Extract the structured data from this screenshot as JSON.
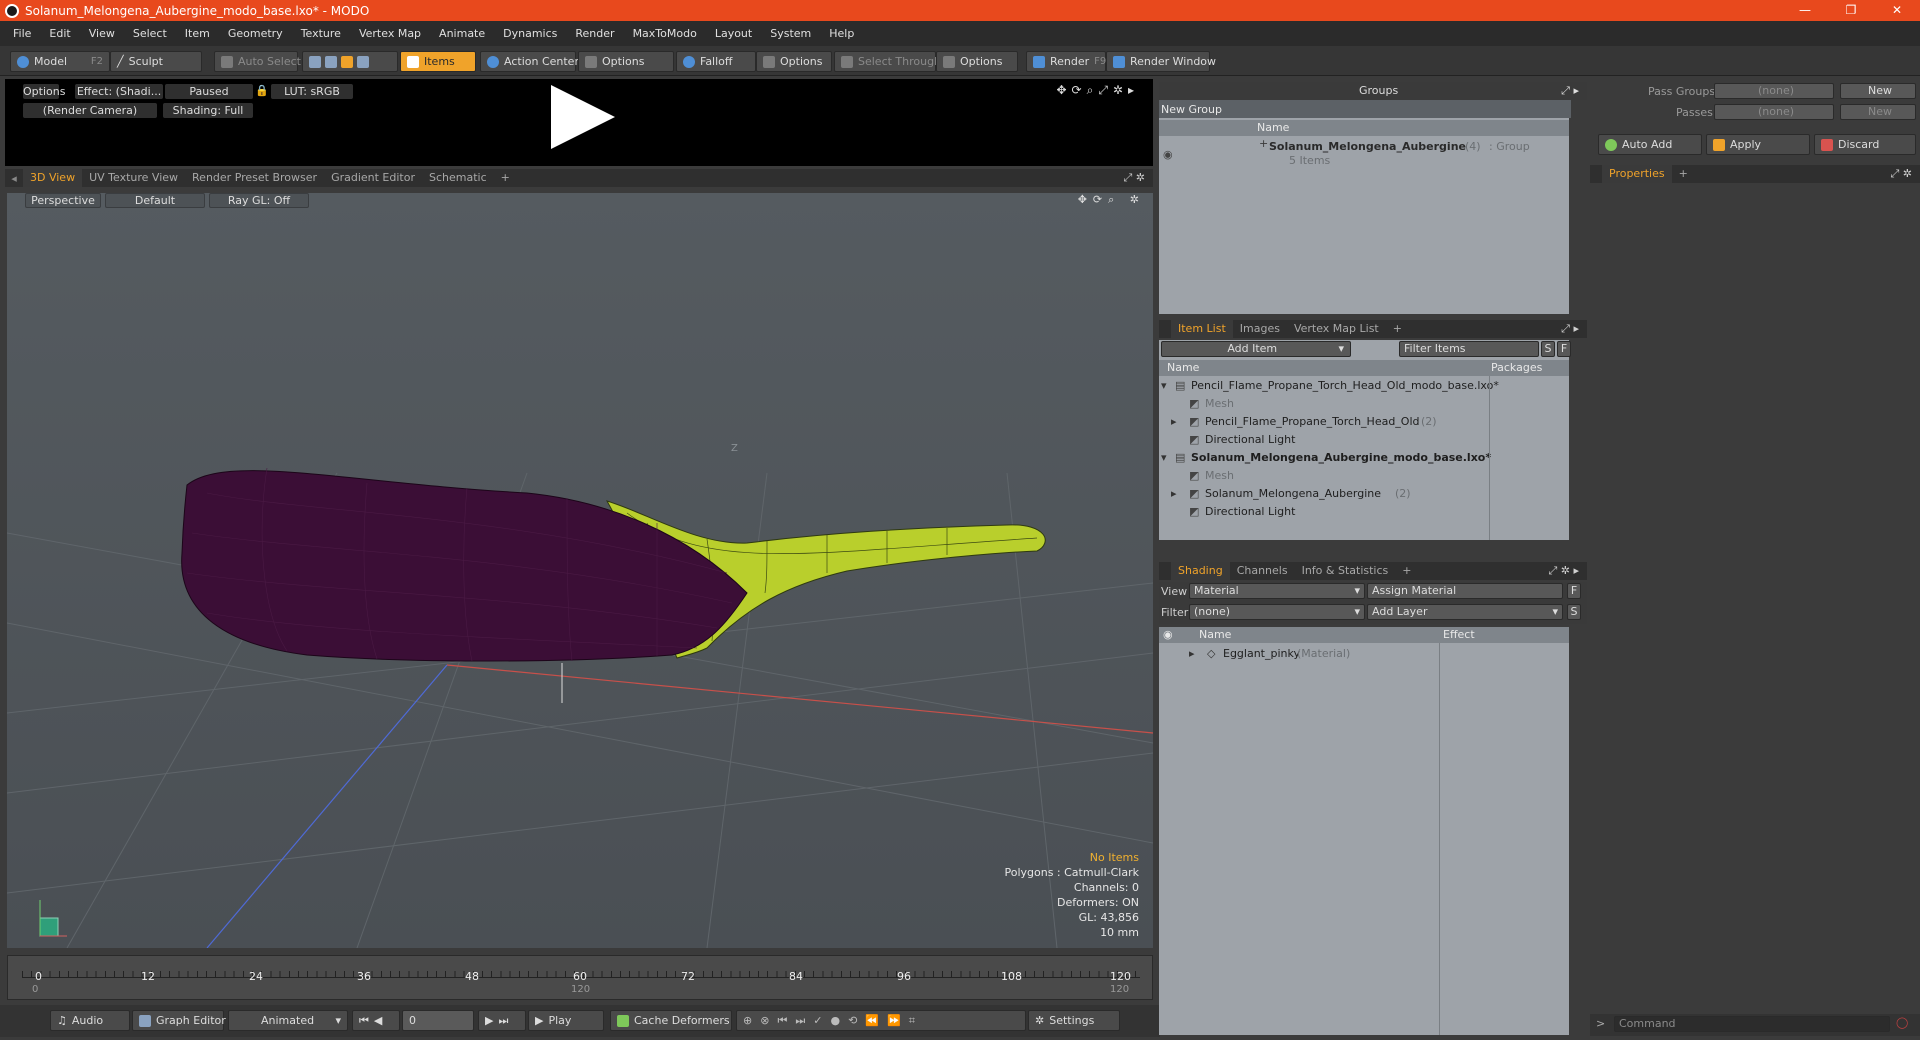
{
  "window": {
    "title": "Solanum_Melongena_Aubergine_modo_base.lxo* - MODO"
  },
  "menu": [
    "File",
    "Edit",
    "View",
    "Select",
    "Item",
    "Geometry",
    "Texture",
    "Vertex Map",
    "Animate",
    "Dynamics",
    "Render",
    "MaxToModo",
    "Layout",
    "System",
    "Help"
  ],
  "toolbar": {
    "model": "Model",
    "model_key": "F2",
    "sculpt": "Sculpt",
    "auto_select": "Auto Select",
    "items": "Items",
    "action_center": "Action Center",
    "options1": "Options",
    "falloff": "Falloff",
    "options2": "Options",
    "select_through": "Select Through",
    "options3": "Options",
    "render": "Render",
    "render_key": "F9",
    "render_window": "Render Window"
  },
  "preview": {
    "options": "Options",
    "effect": "Effect: (Shadi...",
    "paused": "Paused",
    "lut": "LUT: sRGB",
    "camera": "(Render Camera)",
    "shading": "Shading: Full"
  },
  "viewtabs": [
    "3D View",
    "UV Texture View",
    "Render Preset Browser",
    "Gradient Editor",
    "Schematic"
  ],
  "viewport": {
    "perspective": "Perspective",
    "default": "Default",
    "raygl": "Ray GL: Off",
    "axis_label": "Z",
    "stats": {
      "no_items": "No Items",
      "polygons": "Polygons : Catmull-Clark",
      "channels": "Channels: 0",
      "deformers": "Deformers: ON",
      "gl": "GL: 43,856",
      "scale": "10 mm"
    }
  },
  "timeline": {
    "ticks": [
      "0",
      "12",
      "24",
      "36",
      "48",
      "60",
      "72",
      "84",
      "96",
      "108",
      "120"
    ],
    "start": "0",
    "mid": "120",
    "end": "120"
  },
  "bottom": {
    "audio": "Audio",
    "graph_editor": "Graph Editor",
    "animated": "Animated",
    "frame": "0",
    "play": "Play",
    "cache_deformers": "Cache Deformers",
    "settings": "Settings"
  },
  "groups": {
    "title": "Groups",
    "new_group": "New Group",
    "col_name": "Name",
    "row_name": "Solanum_Melongena_Aubergine",
    "row_count": "(4)",
    "row_type": ": Group",
    "row_items": "5 Items"
  },
  "itemlist": {
    "tabs": [
      "Item List",
      "Images",
      "Vertex Map List"
    ],
    "add_item": "Add Item",
    "filter": "Filter Items",
    "s": "S",
    "f": "F",
    "col_name": "Name",
    "col_packages": "Packages",
    "rows": [
      {
        "text": "Pencil_Flame_Propane_Torch_Head_Old_modo_base.lxo*",
        "bold": false,
        "dim": false,
        "indent": 0,
        "suffix": ""
      },
      {
        "text": "Mesh",
        "bold": false,
        "dim": true,
        "indent": 2,
        "suffix": ""
      },
      {
        "text": "Pencil_Flame_Propane_Torch_Head_Old",
        "bold": false,
        "dim": false,
        "indent": 1,
        "suffix": "(2)"
      },
      {
        "text": "Directional Light",
        "bold": false,
        "dim": false,
        "indent": 1,
        "suffix": ""
      },
      {
        "text": "Solanum_Melongena_Aubergine_modo_base.lxo*",
        "bold": true,
        "dim": false,
        "indent": 0,
        "suffix": ""
      },
      {
        "text": "Mesh",
        "bold": false,
        "dim": true,
        "indent": 2,
        "suffix": ""
      },
      {
        "text": "Solanum_Melongena_Aubergine",
        "bold": false,
        "dim": false,
        "indent": 1,
        "suffix": "(2)"
      },
      {
        "text": "Directional Light",
        "bold": false,
        "dim": false,
        "indent": 1,
        "suffix": ""
      }
    ]
  },
  "shading": {
    "tabs": [
      "Shading",
      "Channels",
      "Info & Statistics"
    ],
    "view_label": "View",
    "view_value": "Material",
    "assign": "Assign Material",
    "f": "F",
    "filter_label": "Filter",
    "filter_value": "(none)",
    "add_layer": "Add Layer",
    "s": "S",
    "col_name": "Name",
    "col_effect": "Effect",
    "row_name": "Egglant_pinky",
    "row_type": "(Material)"
  },
  "right": {
    "pass_groups": "Pass Groups",
    "passes": "Passes",
    "none1": "(none)",
    "none2": "(none)",
    "new1": "New",
    "new2": "New",
    "auto_add": "Auto Add",
    "apply": "Apply",
    "discard": "Discard",
    "properties": "Properties",
    "command": "Command"
  }
}
